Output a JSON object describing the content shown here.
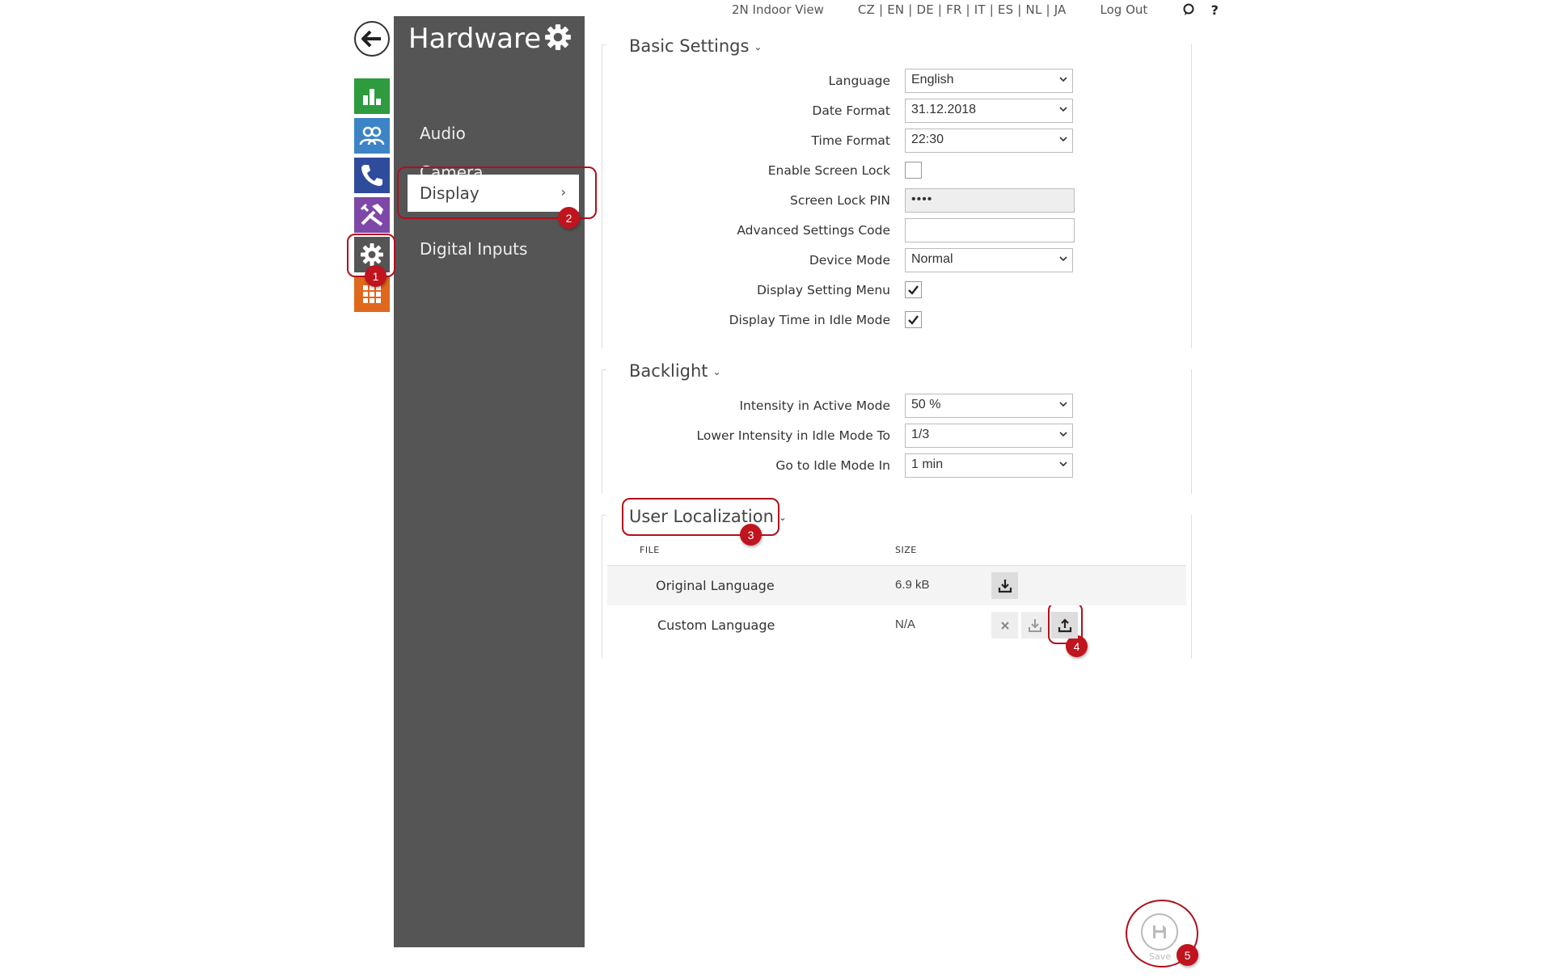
{
  "topbar": {
    "view_link": "2N Indoor View",
    "languages": "CZ | EN | DE | FR | IT | ES | NL | JA",
    "logout": "Log Out",
    "help": "?"
  },
  "sidebar": {
    "title": "Hardware",
    "items": [
      {
        "label": "Audio"
      },
      {
        "label": "Camera"
      },
      {
        "label": "Display"
      },
      {
        "label": "Digital Inputs"
      }
    ]
  },
  "rail_colors": {
    "status": "#2e9b3e",
    "directory": "#3c84c6",
    "calls": "#2f4b9c",
    "services": "#7d48a7",
    "hardware": "#555555",
    "system": "#e0681d"
  },
  "basic_settings": {
    "title": "Basic Settings",
    "language": {
      "label": "Language",
      "value": "English"
    },
    "date_format": {
      "label": "Date Format",
      "value": "31.12.2018"
    },
    "time_format": {
      "label": "Time Format",
      "value": "22:30"
    },
    "screen_lock": {
      "label": "Enable Screen Lock",
      "checked": false
    },
    "screen_lock_pin": {
      "label": "Screen Lock PIN",
      "value": "••••"
    },
    "advanced_code": {
      "label": "Advanced Settings Code",
      "value": ""
    },
    "device_mode": {
      "label": "Device Mode",
      "value": "Normal"
    },
    "display_setting_menu": {
      "label": "Display Setting Menu",
      "checked": true
    },
    "display_time_idle": {
      "label": "Display Time in Idle Mode",
      "checked": true
    }
  },
  "backlight": {
    "title": "Backlight",
    "intensity_active": {
      "label": "Intensity in Active Mode",
      "value": "50 %"
    },
    "lower_intensity": {
      "label": "Lower Intensity in Idle Mode To",
      "value": "1/3"
    },
    "idle_mode_in": {
      "label": "Go to Idle Mode In",
      "value": "1 min"
    }
  },
  "user_localization": {
    "title": "User Localization",
    "columns": {
      "file": "FILE",
      "size": "SIZE"
    },
    "rows": [
      {
        "file": "Original Language",
        "size": "6.9 kB"
      },
      {
        "file": "Custom Language",
        "size": "N/A"
      }
    ]
  },
  "save": {
    "label": "Save"
  },
  "callouts": [
    "1",
    "2",
    "3",
    "4",
    "5"
  ],
  "accent_color": "#c0141e"
}
